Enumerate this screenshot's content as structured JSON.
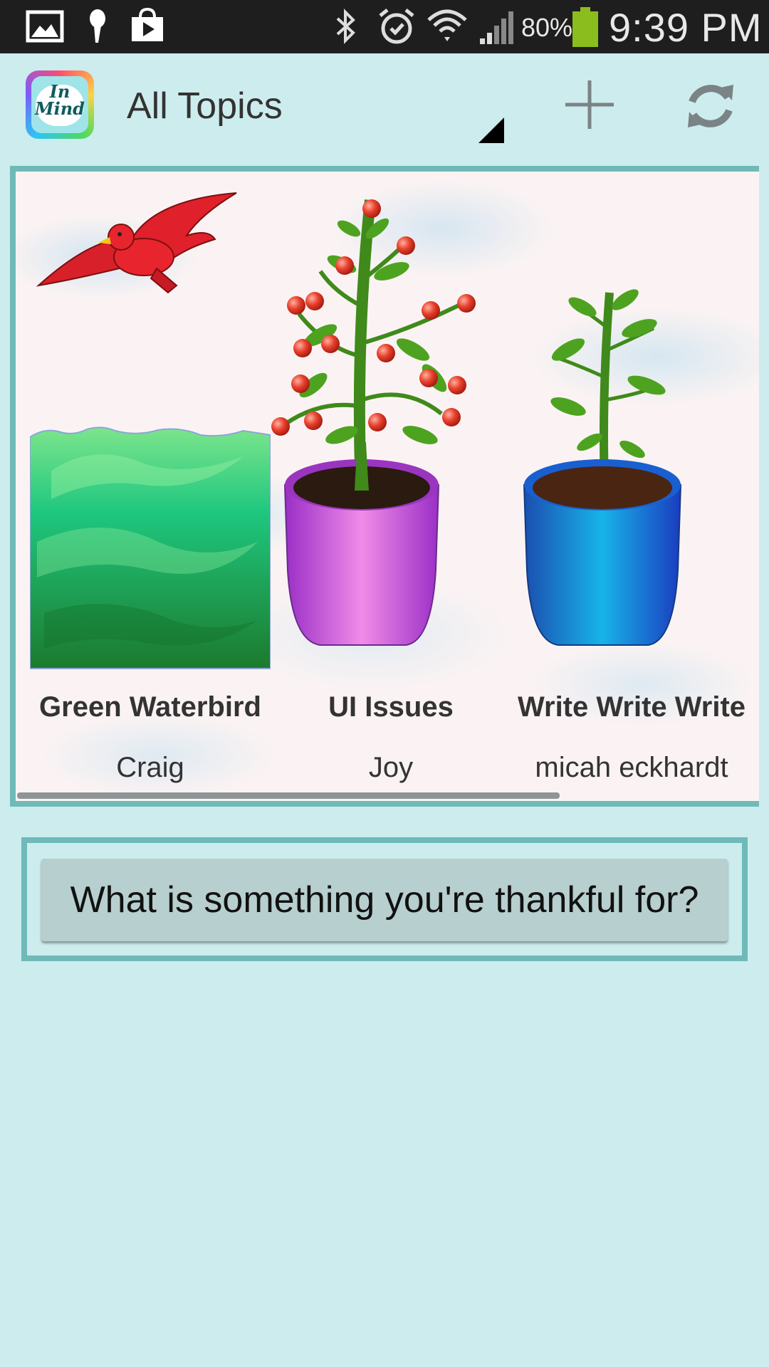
{
  "status_bar": {
    "icons": [
      "gallery-icon",
      "microphone-icon",
      "play-store-icon",
      "bluetooth-icon",
      "alarm-icon",
      "wifi-icon",
      "signal-icon",
      "battery-icon"
    ],
    "battery": "80%",
    "time": "9:39 PM"
  },
  "action_bar": {
    "logo_text_line1": "In",
    "logo_text_line2": "Mind",
    "title": "All Topics",
    "actions": [
      "add-icon",
      "refresh-icon"
    ]
  },
  "topics": [
    {
      "name": "Green Waterbird",
      "author": "Craig",
      "art": "bird-over-water"
    },
    {
      "name": "UI Issues",
      "author": "Joy",
      "art": "fruiting-plant-pink-pot"
    },
    {
      "name": "Write Write Write",
      "author": "micah eckhardt",
      "art": "sprout-blue-pot"
    }
  ],
  "question": {
    "label": "What is something you're thankful for?"
  },
  "colors": {
    "background": "#cdeced",
    "frame_border": "#6fbab8",
    "question_button": "#b7cfce",
    "status_bar": "#1e1e1e"
  }
}
